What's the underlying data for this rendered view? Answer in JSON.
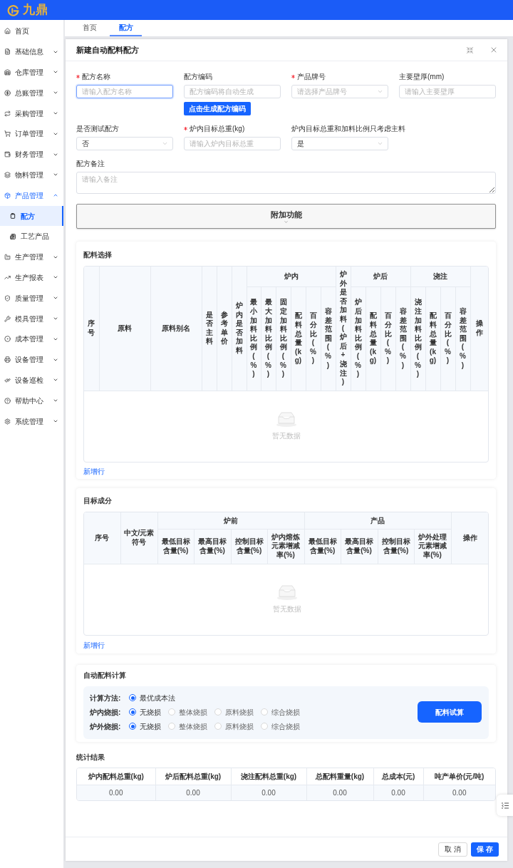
{
  "header": {
    "logo_text": "九鼎"
  },
  "sidebar": {
    "items": [
      {
        "label": "首页",
        "selected": false
      },
      {
        "label": "基础信息",
        "selected": false,
        "expanded": false
      },
      {
        "label": "仓库管理",
        "selected": false,
        "expanded": false
      },
      {
        "label": "总账管理",
        "selected": false,
        "expanded": false
      },
      {
        "label": "采购管理",
        "selected": false,
        "expanded": false
      },
      {
        "label": "订单管理",
        "selected": false,
        "expanded": false
      },
      {
        "label": "财务管理",
        "selected": false,
        "expanded": false
      },
      {
        "label": "物料管理",
        "selected": false,
        "expanded": false
      },
      {
        "label": "产品管理",
        "selected": false,
        "expanded": true,
        "children": [
          {
            "label": "配方",
            "selected": true
          },
          {
            "label": "工艺产品",
            "selected": false
          }
        ]
      },
      {
        "label": "生产管理",
        "selected": false,
        "expanded": false
      },
      {
        "label": "生产报表",
        "selected": false,
        "expanded": false
      },
      {
        "label": "质量管理",
        "selected": false,
        "expanded": false
      },
      {
        "label": "模具管理",
        "selected": false,
        "expanded": false
      },
      {
        "label": "成本管理",
        "selected": false,
        "expanded": false
      },
      {
        "label": "设备管理",
        "selected": false,
        "expanded": false
      },
      {
        "label": "设备巡检",
        "selected": false,
        "expanded": false
      },
      {
        "label": "帮助中心",
        "selected": false,
        "expanded": false
      },
      {
        "label": "系统管理",
        "selected": false,
        "expanded": false
      }
    ]
  },
  "tabs": [
    {
      "label": "首页",
      "selected": false
    },
    {
      "label": "配方",
      "selected": true
    }
  ],
  "dialog": {
    "title": "新建自动配料配方",
    "form": {
      "rows": [
        [
          {
            "label": "配方名称",
            "required": true,
            "kind": "input",
            "placeholder": "请输入配方名称",
            "focused": true
          },
          {
            "label": "配方编码",
            "required": false,
            "kind": "input",
            "placeholder": "配方编码将自动生成",
            "focused": false,
            "button": "点击生成配方编码"
          },
          {
            "label": "产品牌号",
            "required": true,
            "kind": "select",
            "placeholder": "请选择产品牌号"
          },
          {
            "label": "主要壁厚(mm)",
            "required": false,
            "kind": "input",
            "placeholder": "请输入主要壁厚",
            "focused": false
          }
        ],
        [
          {
            "label": "是否测试配方",
            "required": false,
            "kind": "select",
            "value": "否"
          },
          {
            "label": "炉内目标总重(kg)",
            "required": true,
            "kind": "input",
            "placeholder": "请输入炉内目标总重",
            "focused": false
          },
          {
            "label": "炉内目标总重和加料比例只考虑主料",
            "required": false,
            "kind": "select",
            "value": "是"
          }
        ],
        [
          {
            "label": "配方备注",
            "required": false,
            "kind": "textarea",
            "placeholder": "请输入备注",
            "focused": false
          }
        ]
      ]
    },
    "extra_panel": {
      "label": "附加功能",
      "expanded": false
    },
    "ingredients": {
      "title": "配料选择",
      "columns": [
        {
          "label": "序号"
        },
        {
          "label": "原料"
        },
        {
          "label": "原料别名"
        },
        {
          "label": "是否主料"
        },
        {
          "label": "参考单价"
        },
        {
          "label": "炉内是否加料"
        },
        {
          "label": "炉内",
          "children": [
            {
              "label": "最小加料比例(%)"
            },
            {
              "label": "最大加料比例(%)"
            },
            {
              "label": "固定加料比例(%)"
            },
            {
              "label": "配料总量(kg)"
            },
            {
              "label": "百分比(%)"
            },
            {
              "label": "容差范围(%)"
            }
          ]
        },
        {
          "label": "炉外是否加料(炉后+浇注)"
        },
        {
          "label": "炉后",
          "children": [
            {
              "label": "炉后加料比例(%)"
            },
            {
              "label": "配料总量(kg)"
            },
            {
              "label": "百分比(%)"
            },
            {
              "label": "容差范围(%)"
            }
          ]
        },
        {
          "label": "浇注",
          "children": [
            {
              "label": "浇注加料比例(%)"
            },
            {
              "label": "配料总量(kg)"
            },
            {
              "label": "百分比(%)"
            },
            {
              "label": "容差范围(%)"
            }
          ]
        },
        {
          "label": "操作"
        }
      ],
      "empty_text": "暂无数据",
      "add_link": "新增行"
    },
    "targets": {
      "title": "目标成分",
      "columns": [
        {
          "label": "序号"
        },
        {
          "label": "中文/元素符号"
        },
        {
          "label": "炉前",
          "children": [
            {
              "label": "最低目标含量(%)"
            },
            {
              "label": "最高目标含量(%)"
            },
            {
              "label": "控制目标含量(%)"
            },
            {
              "label": "炉内熔炼元素增减率(%)"
            }
          ]
        },
        {
          "label": "产品",
          "children": [
            {
              "label": "最低目标含量(%)"
            },
            {
              "label": "最高目标含量(%)"
            },
            {
              "label": "控制目标含量(%)"
            },
            {
              "label": "炉外处理元素增减率(%)"
            }
          ]
        },
        {
          "label": "操作"
        }
      ],
      "empty_text": "暂无数据",
      "add_link": "新增行"
    },
    "auto_calc": {
      "title": "自动配料计算",
      "rows": [
        {
          "label": "计算方法:",
          "options": [
            {
              "label": "最优成本法",
              "selected": true
            }
          ]
        },
        {
          "label": "炉内烧损:",
          "options": [
            {
              "label": "无烧损",
              "selected": true
            },
            {
              "label": "整体烧损",
              "selected": false
            },
            {
              "label": "原料烧损",
              "selected": false
            },
            {
              "label": "综合烧损",
              "selected": false
            }
          ]
        },
        {
          "label": "炉外烧损:",
          "options": [
            {
              "label": "无烧损",
              "selected": true
            },
            {
              "label": "整体烧损",
              "selected": false
            },
            {
              "label": "原料烧损",
              "selected": false
            },
            {
              "label": "综合烧损",
              "selected": false
            }
          ]
        }
      ],
      "button": "配料试算"
    },
    "stats": {
      "title": "统计结果",
      "columns": [
        "炉内配料总重(kg)",
        "炉后配料总重(kg)",
        "浇注配料总重(kg)",
        "总配料重量(kg)",
        "总成本(元)",
        "吨产单价(元/吨)"
      ],
      "values": [
        "0.00",
        "0.00",
        "0.00",
        "0.00",
        "0.00",
        "0.00"
      ]
    },
    "footer_buttons": [
      {
        "label": "取 消",
        "kind": "secondary"
      },
      {
        "label": "保 存",
        "kind": "primary"
      }
    ]
  }
}
